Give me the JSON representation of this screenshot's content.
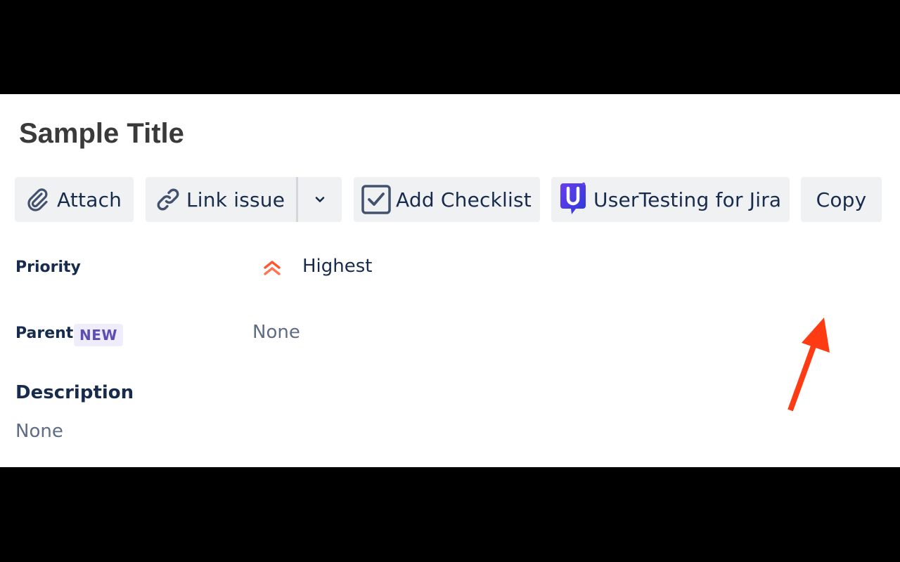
{
  "issue": {
    "title": "Sample Title"
  },
  "toolbar": {
    "attach_label": "Attach",
    "link_issue_label": "Link issue",
    "add_checklist_label": "Add Checklist",
    "usertesting_label": "UserTesting for Jira",
    "copy_label": "Copy"
  },
  "fields": {
    "priority": {
      "label": "Priority",
      "value": "Highest",
      "icon": "priority-highest-icon",
      "icon_color": "#ff5630"
    },
    "parent": {
      "label": "Parent",
      "badge": "NEW",
      "value": "None"
    }
  },
  "description": {
    "heading": "Description",
    "value": "None"
  },
  "colors": {
    "annotation_arrow": "#ff3b14",
    "button_bg": "#f0f1f3",
    "text_primary": "#172b4d",
    "text_muted": "#5e6c84",
    "usertesting_brand": "#3f2fd6"
  }
}
